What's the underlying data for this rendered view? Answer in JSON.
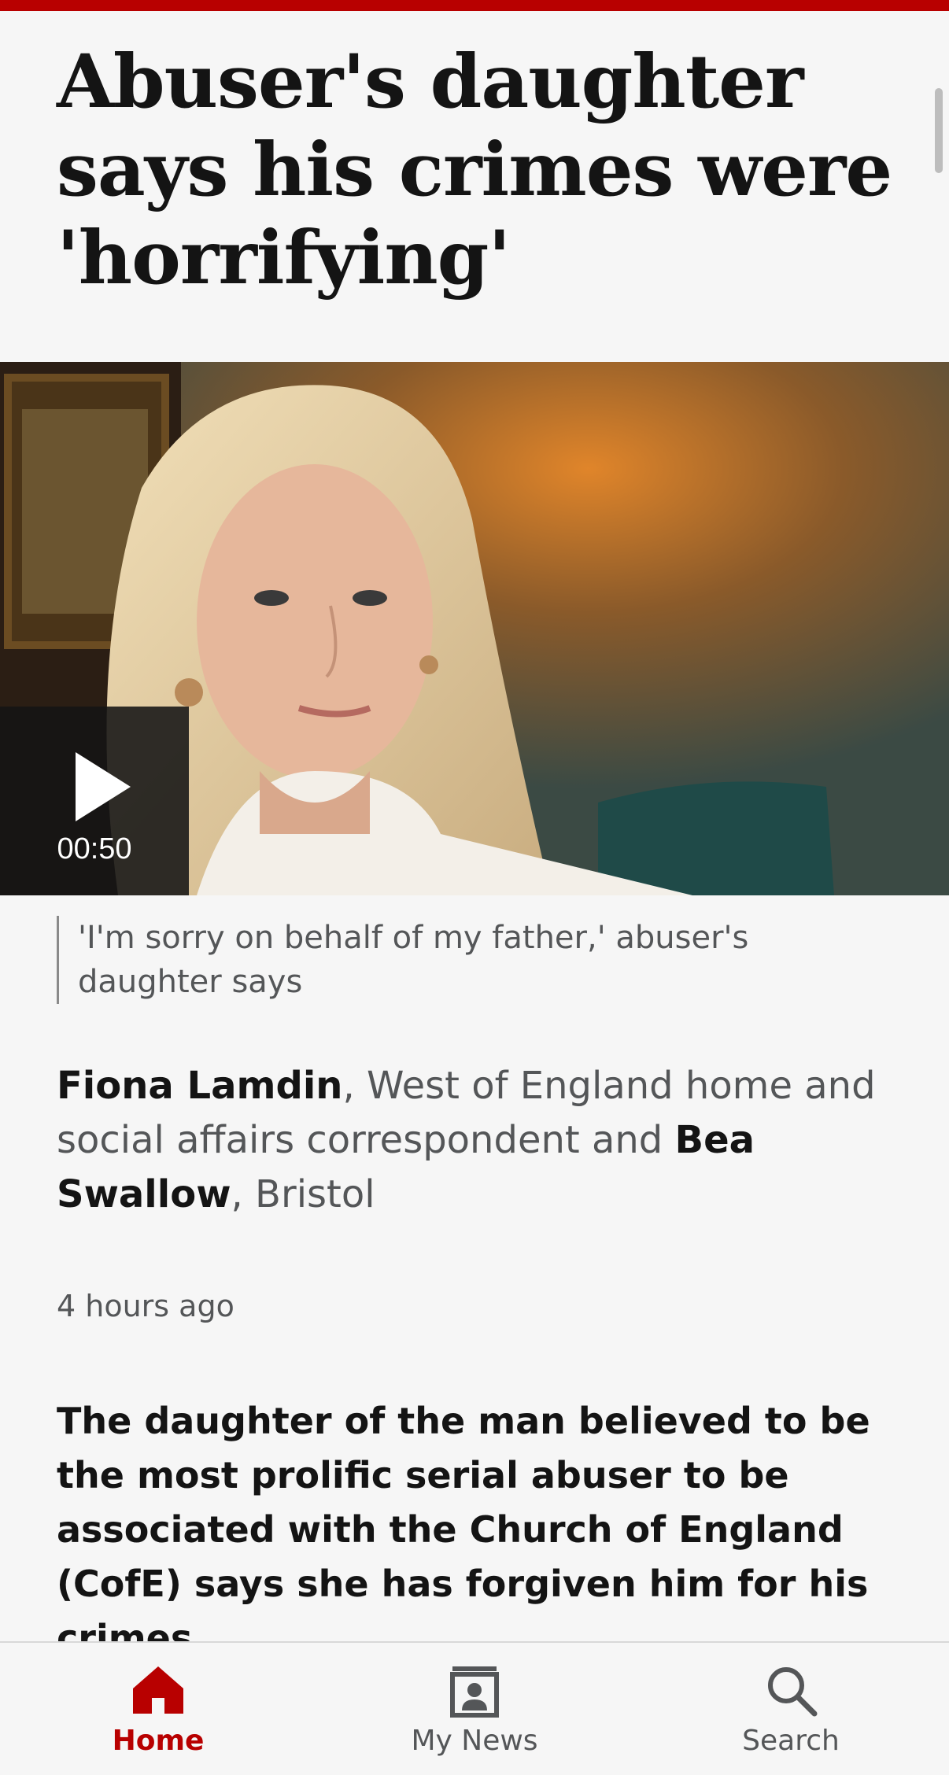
{
  "article": {
    "headline": "Abuser's daughter says his crimes were 'horrifying'",
    "video": {
      "duration": "00:50",
      "caption": "'I'm sorry on behalf of my father,' abuser's daughter says"
    },
    "byline": {
      "author1": "Fiona Lamdin",
      "author1_role": ", West of England home and social affairs correspondent and ",
      "author2": "Bea Swallow",
      "author2_role": ", Bristol"
    },
    "timestamp": "4 hours ago",
    "lede": "The daughter of the man believed to be the most prolific serial abuser to be associated with the Church of England (CofE) says she has forgiven him for his crimes."
  },
  "bottom_nav": {
    "items": [
      {
        "label": "Home",
        "icon": "home-icon",
        "active": true
      },
      {
        "label": "My News",
        "icon": "my-news-icon",
        "active": false
      },
      {
        "label": "Search",
        "icon": "search-icon",
        "active": false
      }
    ]
  },
  "colors": {
    "accent": "#b80000",
    "text": "#141414",
    "secondary_text": "#545658",
    "background": "#f6f6f6"
  }
}
